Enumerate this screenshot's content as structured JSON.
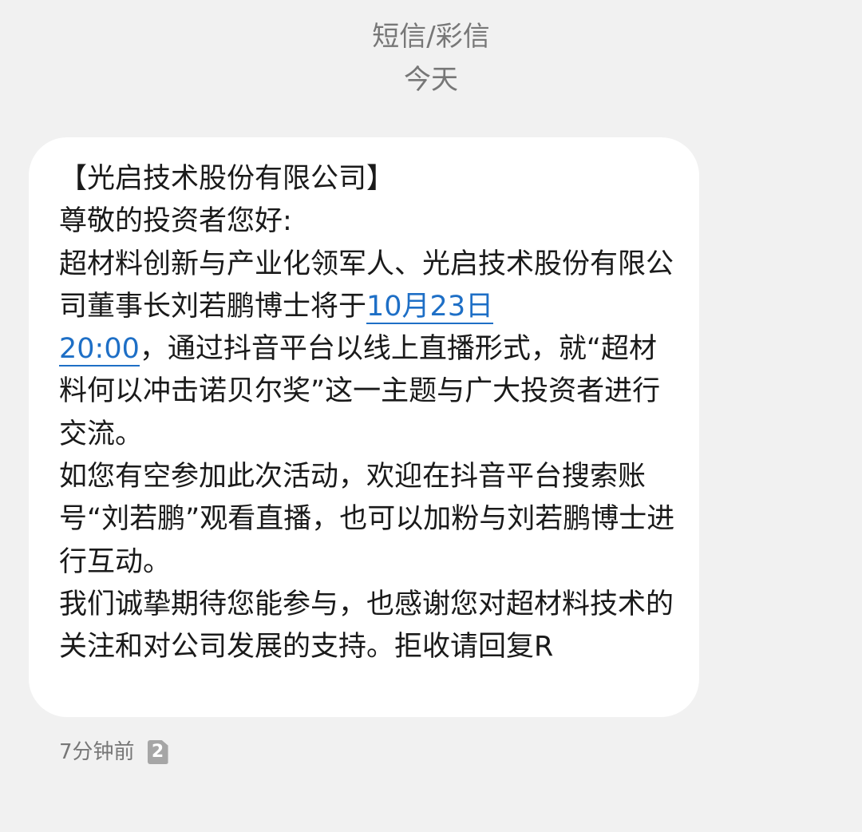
{
  "header": {
    "channel": "短信/彩信",
    "date_separator": "今天"
  },
  "message": {
    "part1": "【光启技术股份有限公司】\n尊敬的投资者您好:\n超材料创新与产业化领军人、光启技术股份有限公司董事长刘若鹏博士将于",
    "date_link_1": "10月23日",
    "date_link_2": "20:00",
    "part2": "，通过抖音平台以线上直播形式，就“超材料何以冲击诺贝尔奖”这一主题与广大投资者进行交流。\n如您有空参加此次活动，欢迎在抖音平台搜索账号“刘若鹏”观看直播，也可以加粉与刘若鹏博士进行互动。\n我们诚挚期待您能参与，也感谢您对超材料技术的关注和对公司发展的支持。拒收请回复R",
    "time": "7分钟前",
    "sim": "2"
  },
  "colors": {
    "background": "#f1f1f1",
    "bubble": "#ffffff",
    "link": "#1e6fc6",
    "secondary_text": "#777777"
  }
}
